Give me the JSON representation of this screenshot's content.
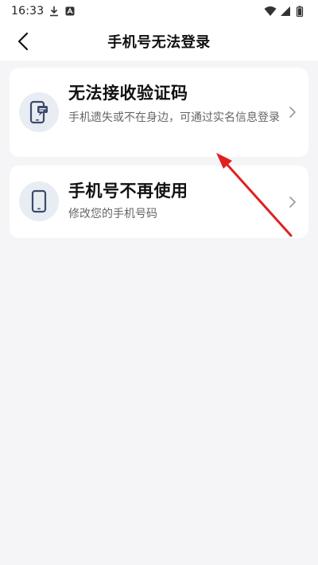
{
  "status_bar": {
    "time": "16:33",
    "icons": [
      "download-icon",
      "notification-icon",
      "wifi-icon",
      "signal-icon",
      "battery-icon"
    ]
  },
  "nav": {
    "title": "手机号无法登录",
    "back_icon": "chevron-left-icon"
  },
  "options": [
    {
      "title": "无法接收验证码",
      "description": "手机遗失或不在身边，可通过实名信息登录",
      "icon": "phone-message-icon"
    },
    {
      "title": "手机号不再使用",
      "description": "修改您的手机号码",
      "icon": "phone-icon"
    }
  ],
  "colors": {
    "background": "#f5f5f7",
    "card": "#ffffff",
    "icon_bg": "#e8ecf3",
    "icon_fg": "#3d4a6b",
    "annotation_arrow": "#e02020"
  }
}
